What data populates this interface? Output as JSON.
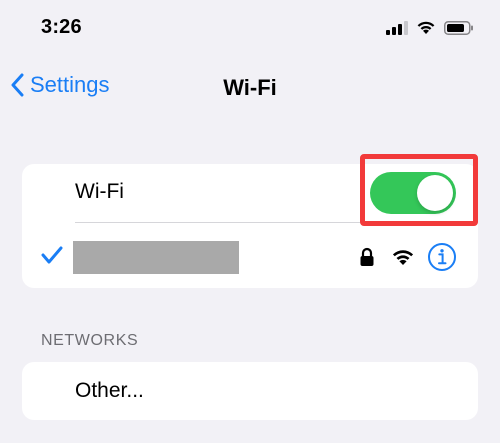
{
  "status_bar": {
    "time": "3:26",
    "icons": [
      "cellular-signal-icon",
      "wifi-status-icon",
      "battery-icon"
    ]
  },
  "nav": {
    "back_label": "Settings",
    "title": "Wi-Fi"
  },
  "wifi_card": {
    "toggle_label": "Wi-Fi",
    "toggle_on": true,
    "connected_network": {
      "name_redacted": true,
      "icons": [
        "checkmark-icon",
        "lock-icon",
        "wifi-signal-icon",
        "info-icon"
      ]
    }
  },
  "networks_section": {
    "header": "NETWORKS",
    "items": [
      {
        "label": "Other..."
      }
    ]
  },
  "colors": {
    "background": "#f2f1f6",
    "accent_blue": "#1a7ef5",
    "toggle_green": "#34c759",
    "highlight_red": "#f23a3a",
    "redaction_gray": "#a9a9a9"
  }
}
